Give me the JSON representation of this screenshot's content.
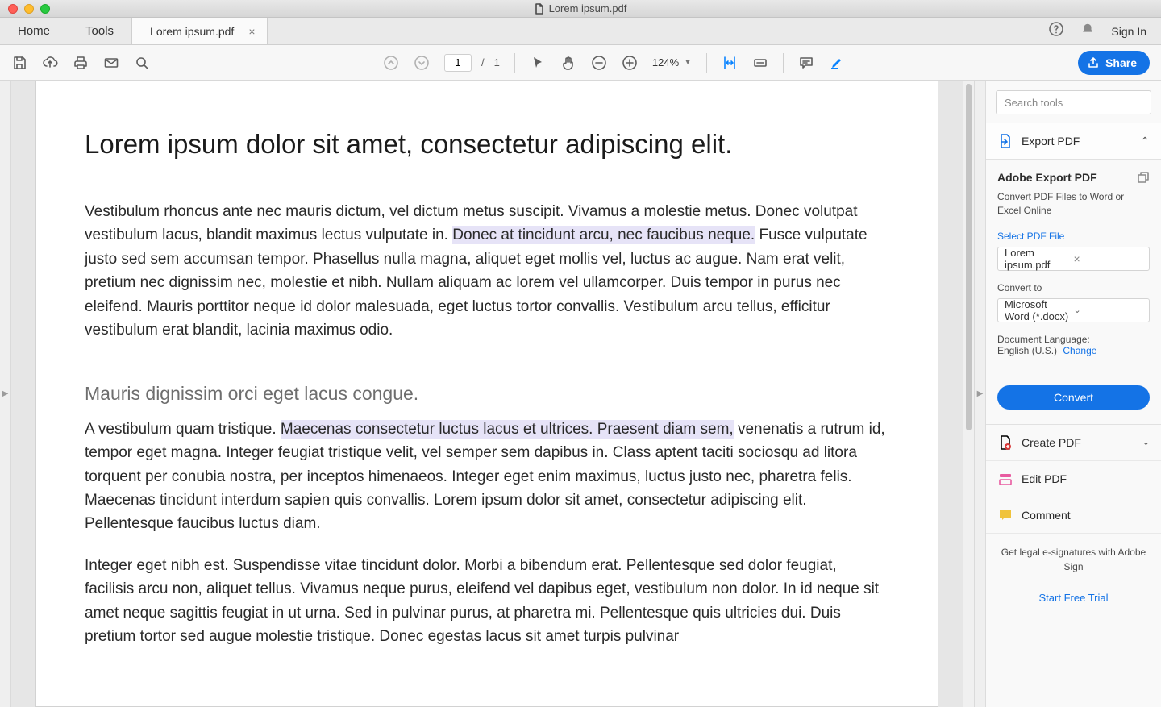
{
  "window": {
    "title": "Lorem ipsum.pdf"
  },
  "tabs": {
    "home": "Home",
    "tools": "Tools",
    "doc": "Lorem ipsum.pdf",
    "signin": "Sign In"
  },
  "toolbar": {
    "page_current": "1",
    "page_sep": "/",
    "page_total": "1",
    "zoom": "124%",
    "share": "Share"
  },
  "document": {
    "h1": "Lorem ipsum dolor sit amet, consectetur adipiscing elit.",
    "p1a": "Vestibulum rhoncus ante nec mauris dictum, vel dictum metus suscipit. Vivamus a molestie metus. Donec volutpat vestibulum lacus, blandit maximus lectus vulputate in. ",
    "p1h": "Donec at tincidunt arcu, nec faucibus neque.",
    "p1b": " Fusce vulputate justo sed sem accumsan tempor. Phasellus nulla magna, aliquet eget mollis vel, luctus ac augue. Nam erat velit, pretium nec dignissim nec, molestie et nibh. Nullam aliquam ac lorem vel ullamcorper. Duis tempor in purus nec eleifend. Mauris porttitor neque id dolor malesuada, eget luctus tortor convallis. Vestibulum arcu tellus, efficitur vestibulum erat blandit, lacinia maximus odio.",
    "h2": "Mauris dignissim orci eget lacus congue.",
    "p2a": "A vestibulum quam tristique. ",
    "p2h": "Maecenas consectetur luctus lacus et ultrices. Praesent diam sem,",
    "p2b": " venenatis a rutrum id, tempor eget magna. Integer feugiat tristique velit, vel semper sem dapibus in. Class aptent taciti sociosqu ad litora torquent per conubia nostra, per inceptos himenaeos. Integer eget enim maximus, luctus justo nec, pharetra felis. Maecenas tincidunt interdum sapien quis convallis. Lorem ipsum dolor sit amet, consectetur adipiscing elit. Pellentesque faucibus luctus diam.",
    "p3": "Integer eget nibh est. Suspendisse vitae tincidunt dolor. Morbi a bibendum erat. Pellentesque sed dolor feugiat, facilisis arcu non, aliquet tellus. Vivamus neque purus, eleifend vel dapibus eget, vestibulum non dolor. In id neque sit amet neque sagittis feugiat in ut urna. Sed in pulvinar purus, at pharetra mi. Pellentesque quis ultricies dui. Duis pretium tortor sed augue molestie tristique. Donec egestas lacus sit amet turpis pulvinar"
  },
  "rpanel": {
    "search_placeholder": "Search tools",
    "export_hd": "Export PDF",
    "export_title": "Adobe Export PDF",
    "export_desc": "Convert PDF Files to Word or Excel Online",
    "select_label": "Select PDF File",
    "file_name": "Lorem ipsum.pdf",
    "convert_to": "Convert to",
    "format": "Microsoft Word (*.docx)",
    "lang_label": "Document Language:",
    "lang_value": "English (U.S.)",
    "lang_change": "Change",
    "convert_btn": "Convert",
    "create": "Create PDF",
    "edit": "Edit PDF",
    "comment": "Comment",
    "foot1": "Get legal e-signatures with Adobe Sign",
    "foot_link": "Start Free Trial"
  }
}
